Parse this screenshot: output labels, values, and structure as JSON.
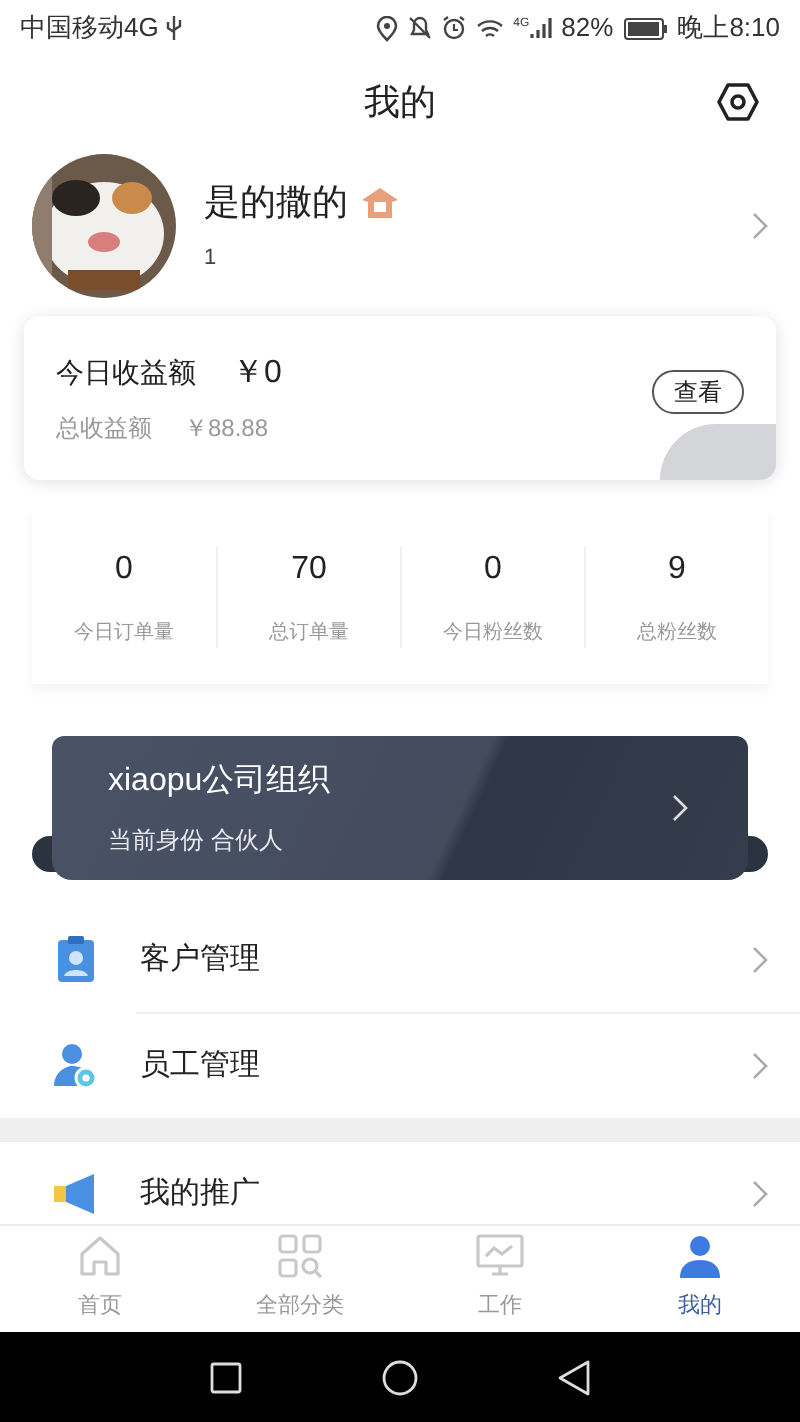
{
  "status_bar": {
    "carrier": "中国移动4G",
    "network": "4G",
    "battery": "82%",
    "time": "晚上8:10"
  },
  "header": {
    "title": "我的"
  },
  "profile": {
    "name": "是的撒的",
    "phone": "1"
  },
  "earnings": {
    "today_label": "今日收益额",
    "today_value": "￥0",
    "total_label": "总收益额",
    "total_value": "￥88.88",
    "button": "查看"
  },
  "stats": [
    {
      "value": "0",
      "label": "今日订单量"
    },
    {
      "value": "70",
      "label": "总订单量"
    },
    {
      "value": "0",
      "label": "今日粉丝数"
    },
    {
      "value": "9",
      "label": "总粉丝数"
    }
  ],
  "organization": {
    "name": "xiaopu公司组织",
    "role": "当前身份 合伙人"
  },
  "menu": [
    {
      "kind": "customer",
      "label": "客户管理"
    },
    {
      "kind": "staff",
      "label": "员工管理"
    },
    {
      "kind": "promotion",
      "label": "我的推广"
    }
  ],
  "tabs": [
    {
      "kind": "home",
      "label": "首页",
      "selected": false
    },
    {
      "kind": "category",
      "label": "全部分类",
      "selected": false
    },
    {
      "kind": "work",
      "label": "工作",
      "selected": false
    },
    {
      "kind": "me",
      "label": "我的",
      "selected": true
    }
  ]
}
